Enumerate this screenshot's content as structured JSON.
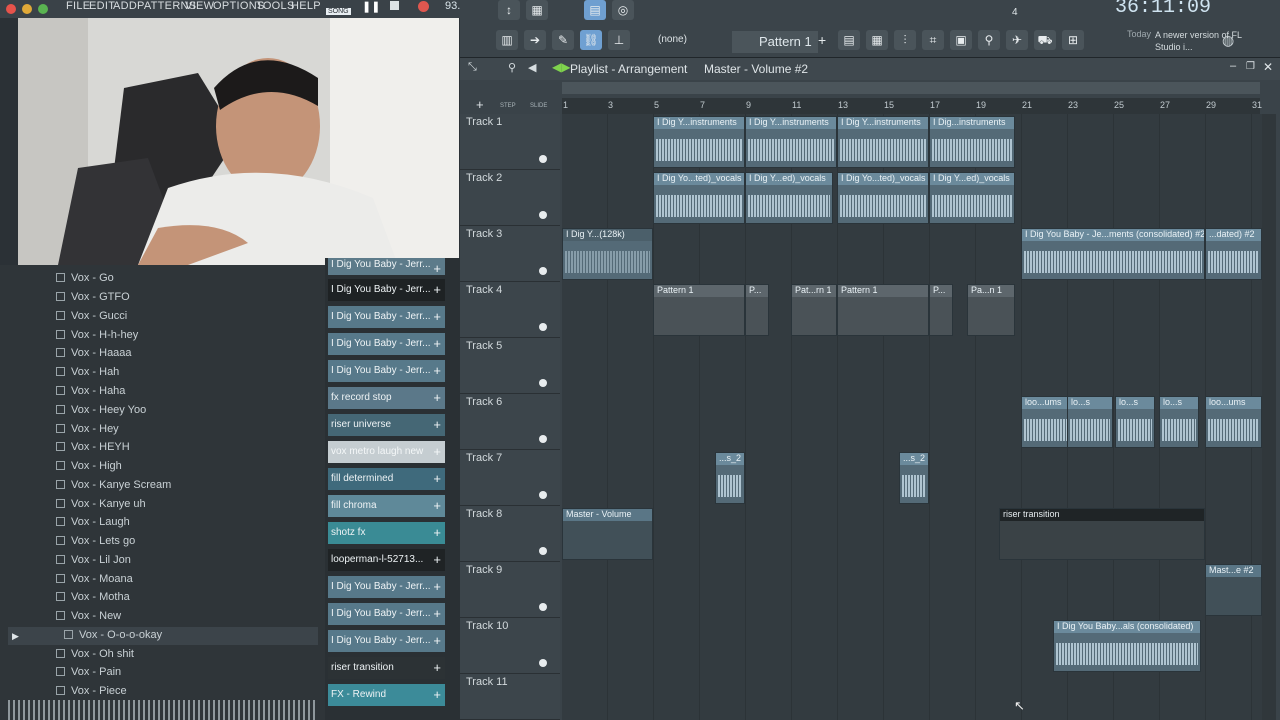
{
  "menu": [
    "FILE",
    "EDIT",
    "ADD",
    "PATTERNS",
    "VIEW",
    "OPTIONS",
    "TOOLS",
    "HELP"
  ],
  "song_badge": "SONG",
  "tempo": "93.000",
  "time_display": "36:11:09",
  "pattern_selector": "Pattern 1",
  "snap": "(none)",
  "news": {
    "label": "Today",
    "text": "A newer version of FL Studio i..."
  },
  "step_count": "4",
  "playlist_title": "Playlist - Arrangement",
  "breadcrumb": "Master - Volume #2",
  "ruler_ticks": [
    "1",
    "3",
    "5",
    "7",
    "9",
    "11",
    "13",
    "15",
    "17",
    "19",
    "21",
    "23",
    "25",
    "27",
    "29",
    "31"
  ],
  "step_label": "STEP",
  "slide_label": "SLIDE",
  "browser_items": [
    "Vox - Go",
    "Vox - GTFO",
    "Vox - Gucci",
    "Vox - H-h-hey",
    "Vox - Haaaa",
    "Vox - Hah",
    "Vox - Haha",
    "Vox - Heey Yoo",
    "Vox - Hey",
    "Vox - HEYH",
    "Vox - High",
    "Vox - Kanye Scream",
    "Vox - Kanye uh",
    "Vox - Laugh",
    "Vox - Lets go",
    "Vox - Lil Jon",
    "Vox - Moana",
    "Vox - Motha",
    "Vox - New",
    "Vox - O-o-o-okay",
    "Vox - Oh shit",
    "Vox - Pain",
    "Vox - Piece"
  ],
  "channels": [
    "I Dig You Baby - Jerr...",
    "I Dig You Baby - Jerr...",
    "I Dig You Baby - Jerr...",
    "I Dig You Baby - Jerr...",
    "fx record stop",
    "riser universe",
    "vox metro laugh new",
    "fill determined",
    "fill chroma",
    "shotz fx",
    "looperman-l-52713...",
    "I Dig You Baby - Jerr...",
    "I Dig You Baby - Jerr...",
    "I Dig You Baby - Jerr...",
    "riser transition",
    "FX - Rewind"
  ],
  "tracks": [
    "Track 1",
    "Track 2",
    "Track 3",
    "Track 4",
    "Track 5",
    "Track 6",
    "Track 7",
    "Track 8",
    "Track 9",
    "Track 10",
    "Track 11"
  ],
  "clip_labels": {
    "t1a": "I Dig Y...instruments",
    "t1b": "I Dig Y...instruments",
    "t1c": "I Dig Y...instruments",
    "t1d": "I Dig...instruments",
    "t2a": "I Dig Yo...ted)_vocals",
    "t2b": "I Dig Y...ed)_vocals",
    "t2c": "I Dig Yo...ted)_vocals",
    "t2d": "I Dig Y...ed)_vocals",
    "t3a": "I Dig Y...(128k)",
    "t3b": "I Dig You Baby - Je...ments (consolidated) #2",
    "t3c": "...dated) #2",
    "t4a": "Pattern 1",
    "t4b": "P...",
    "t4c": "Pat...rn 1",
    "t4d": "Pattern 1",
    "t4e": "P...",
    "t4f": "Pa...n 1",
    "t6a": "loo...ums",
    "t6b": "lo...s",
    "t6c": "lo...s",
    "t6d": "lo...s",
    "t6e": "loo...ums",
    "t7a": "...s_2",
    "t7b": "...s_2",
    "t8a": "Master - Volume",
    "t8b": "riser transition",
    "t9a": "Mast...e #2",
    "t10a": "I Dig You Baby...als (consolidated)"
  }
}
